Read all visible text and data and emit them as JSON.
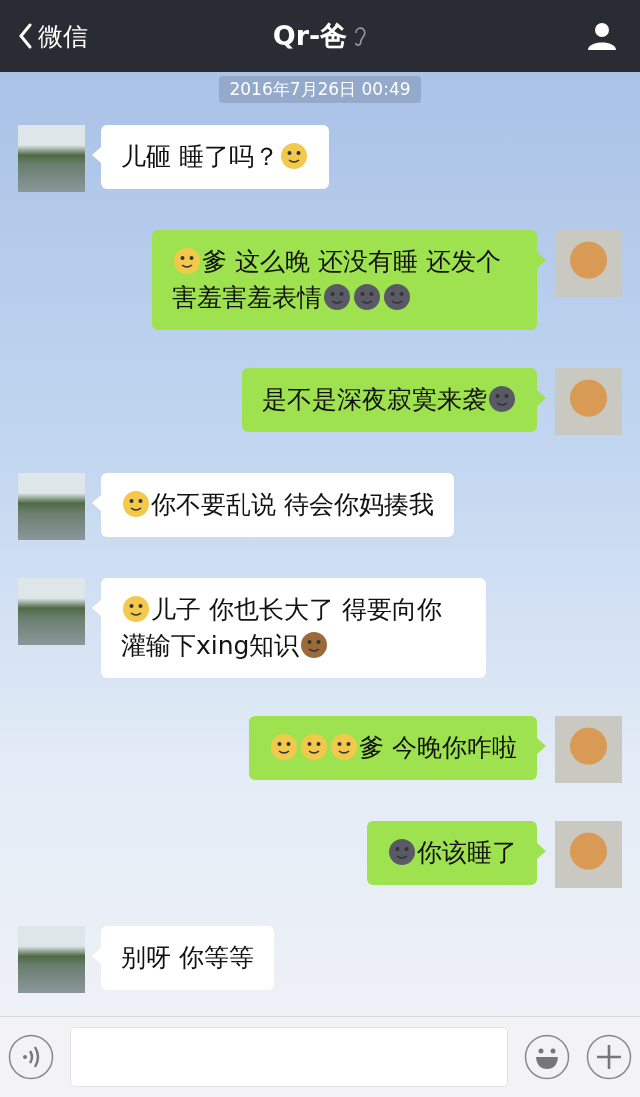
{
  "header": {
    "back_label": "微信",
    "title": "Qr-爸"
  },
  "timestamp": "2016年7月26日 00:49",
  "messages": [
    {
      "kind": "incoming",
      "parts": [
        {
          "kind": "text",
          "text": "儿砸 睡了吗？"
        },
        {
          "kind": "emoji",
          "color": "#f2c94c"
        }
      ]
    },
    {
      "kind": "outgoing",
      "parts": [
        {
          "kind": "emoji",
          "color": "#f2c94c"
        },
        {
          "kind": "text",
          "text": "爹 这么晚 还没有睡 还发个害羞害羞表情"
        },
        {
          "kind": "emoji",
          "color": "#5a5a66"
        },
        {
          "kind": "emoji",
          "color": "#5a5a66"
        },
        {
          "kind": "emoji",
          "color": "#5a5a66"
        }
      ]
    },
    {
      "kind": "outgoing",
      "parts": [
        {
          "kind": "text",
          "text": "是不是深夜寂寞来袭"
        },
        {
          "kind": "emoji",
          "color": "#5a5a66"
        }
      ]
    },
    {
      "kind": "incoming",
      "parts": [
        {
          "kind": "emoji",
          "color": "#f2c94c"
        },
        {
          "kind": "text",
          "text": "你不要乱说 待会你妈揍我"
        }
      ]
    },
    {
      "kind": "incoming",
      "parts": [
        {
          "kind": "emoji",
          "color": "#f2c94c"
        },
        {
          "kind": "text",
          "text": "儿子 你也长大了  得要向你灌输下xing知识"
        },
        {
          "kind": "emoji",
          "color": "#9a6a3a"
        }
      ]
    },
    {
      "kind": "outgoing",
      "parts": [
        {
          "kind": "emoji",
          "color": "#f2c94c"
        },
        {
          "kind": "emoji",
          "color": "#f2c94c"
        },
        {
          "kind": "emoji",
          "color": "#f2c94c"
        },
        {
          "kind": "text",
          "text": "爹 今晚你咋啦"
        }
      ]
    },
    {
      "kind": "outgoing",
      "parts": [
        {
          "kind": "emoji",
          "color": "#5a5a66"
        },
        {
          "kind": "text",
          "text": "你该睡了"
        }
      ]
    },
    {
      "kind": "incoming",
      "parts": [
        {
          "kind": "text",
          "text": "别呀 你等等"
        }
      ]
    }
  ]
}
